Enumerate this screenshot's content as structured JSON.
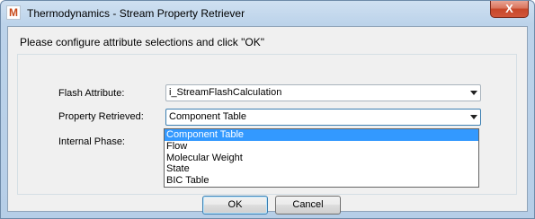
{
  "window": {
    "title": "Thermodynamics - Stream Property Retriever",
    "app_icon_glyph": "M",
    "close_glyph": "X"
  },
  "instruction": "Please configure attribute selections and click \"OK\"",
  "fields": {
    "flash_attribute": {
      "label": "Flash Attribute:",
      "value": "i_StreamFlashCalculation"
    },
    "property_retrieved": {
      "label": "Property Retrieved:",
      "value": "Component Table"
    },
    "internal_phase": {
      "label": "Internal Phase:"
    }
  },
  "dropdown": {
    "options": [
      "Component Table",
      "Flow",
      "Molecular Weight",
      "State",
      "BIC Table"
    ],
    "selected_index": 0
  },
  "buttons": {
    "ok": "OK",
    "cancel": "Cancel"
  },
  "colors": {
    "selection": "#3399ff",
    "close_button": "#c74729"
  }
}
